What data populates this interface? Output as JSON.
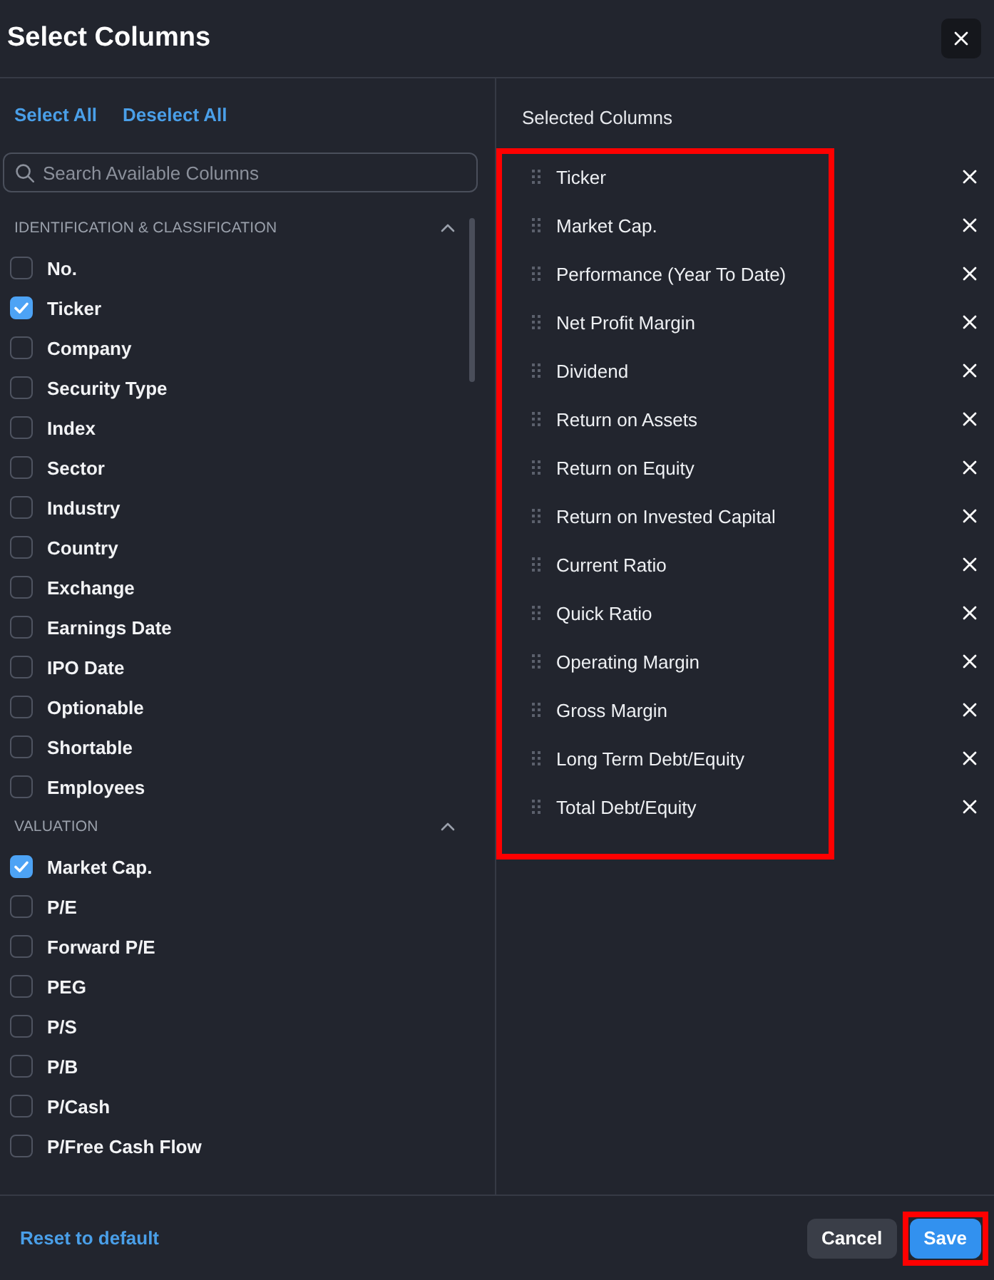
{
  "dialog": {
    "title": "Select Columns"
  },
  "available": {
    "select_all": "Select All",
    "deselect_all": "Deselect All",
    "search": {
      "placeholder": "Search Available Columns"
    },
    "sections": [
      {
        "title": "IDENTIFICATION & CLASSIFICATION",
        "expanded": true,
        "items": [
          {
            "label": "No.",
            "checked": false
          },
          {
            "label": "Ticker",
            "checked": true
          },
          {
            "label": "Company",
            "checked": false
          },
          {
            "label": "Security Type",
            "checked": false
          },
          {
            "label": "Index",
            "checked": false
          },
          {
            "label": "Sector",
            "checked": false
          },
          {
            "label": "Industry",
            "checked": false
          },
          {
            "label": "Country",
            "checked": false
          },
          {
            "label": "Exchange",
            "checked": false
          },
          {
            "label": "Earnings Date",
            "checked": false
          },
          {
            "label": "IPO Date",
            "checked": false
          },
          {
            "label": "Optionable",
            "checked": false
          },
          {
            "label": "Shortable",
            "checked": false
          },
          {
            "label": "Employees",
            "checked": false
          }
        ]
      },
      {
        "title": "VALUATION",
        "expanded": true,
        "items": [
          {
            "label": "Market Cap.",
            "checked": true
          },
          {
            "label": "P/E",
            "checked": false
          },
          {
            "label": "Forward P/E",
            "checked": false
          },
          {
            "label": "PEG",
            "checked": false
          },
          {
            "label": "P/S",
            "checked": false
          },
          {
            "label": "P/B",
            "checked": false
          },
          {
            "label": "P/Cash",
            "checked": false
          },
          {
            "label": "P/Free Cash Flow",
            "checked": false
          }
        ]
      }
    ]
  },
  "selected": {
    "title": "Selected Columns",
    "highlighted": true,
    "items": [
      "Ticker",
      "Market Cap.",
      "Performance (Year To Date)",
      "Net Profit Margin",
      "Dividend",
      "Return on Assets",
      "Return on Equity",
      "Return on Invested Capital",
      "Current Ratio",
      "Quick Ratio",
      "Operating Margin",
      "Gross Margin",
      "Long Term Debt/Equity",
      "Total Debt/Equity"
    ]
  },
  "footer": {
    "reset": "Reset to default",
    "buttons": [
      {
        "label": "Cancel",
        "kind": "secondary",
        "highlighted": false
      },
      {
        "label": "Save",
        "kind": "primary",
        "highlighted": true
      }
    ]
  }
}
